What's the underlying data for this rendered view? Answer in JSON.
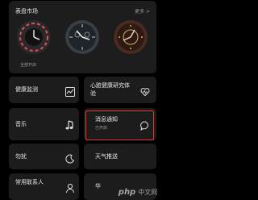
{
  "market": {
    "title": "表盘市场",
    "more": "更多 >",
    "faces": [
      {
        "name": "watch-face-1",
        "label": "全部开启"
      },
      {
        "name": "watch-face-2",
        "label": ""
      },
      {
        "name": "watch-face-3",
        "label": ""
      }
    ]
  },
  "tiles": {
    "health_monitor": {
      "label": "健康监测",
      "icon": "chart-icon"
    },
    "heart_research": {
      "label": "心脏健康研究体验",
      "icon": "heart-icon"
    },
    "music": {
      "label": "音乐",
      "icon": "music-note-icon"
    },
    "notifications": {
      "label": "消息通知",
      "sub": "已开启",
      "icon": "chat-bubble-icon"
    },
    "dnd": {
      "label": "勿扰",
      "icon": "moon-icon"
    },
    "weather": {
      "label": "天气推送",
      "icon": ""
    },
    "contacts": {
      "label": "常用联系人",
      "icon": "person-icon"
    },
    "partial": {
      "label": "华"
    }
  },
  "watermark": {
    "text": "php",
    "sub": "中文网"
  },
  "colors": {
    "highlight": "#e3392a",
    "accent": "#e23b4a"
  }
}
